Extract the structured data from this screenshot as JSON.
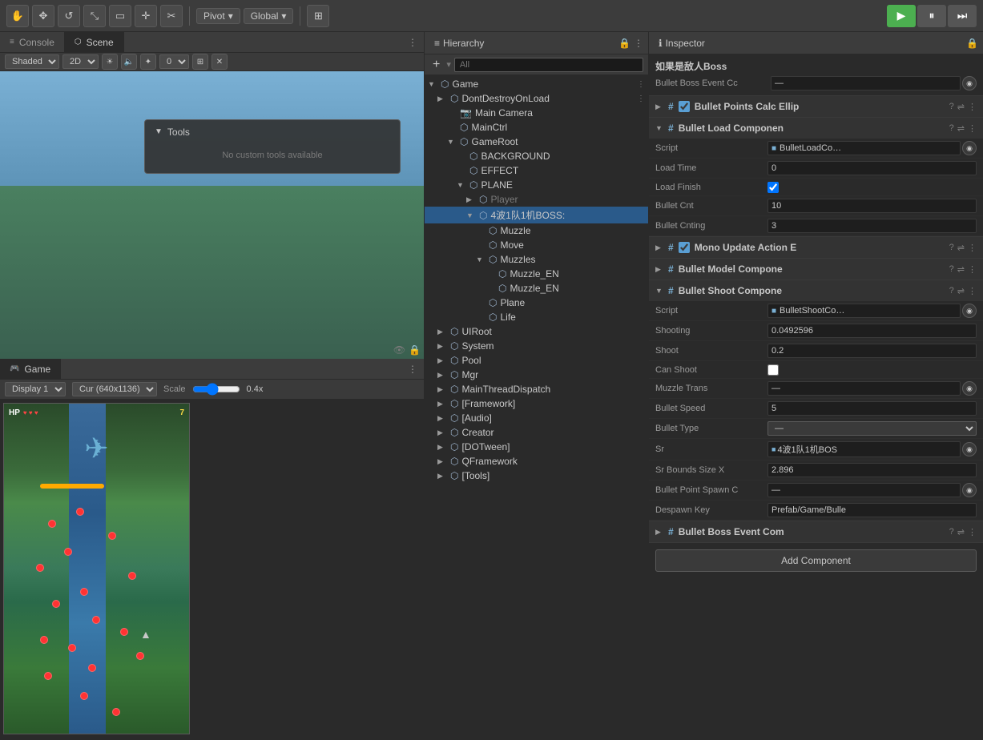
{
  "toolbar": {
    "pivot_label": "Pivot",
    "global_label": "Global",
    "shaded_label": "Shaded",
    "twoD_label": "2D",
    "play_label": "▶",
    "pause_label": "⏸",
    "step_label": "⏭"
  },
  "panels": {
    "console_label": "Console",
    "scene_label": "Scene",
    "hierarchy_label": "Hierarchy",
    "inspector_label": "Inspector",
    "game_label": "Game"
  },
  "scene_toolbar": {
    "shaded_option": "Shaded",
    "twoD_option": "2D"
  },
  "game_toolbar": {
    "display_label": "Display 1",
    "resolution_label": "Cur (640x1136)",
    "scale_label": "Scale",
    "scale_value": "0.4x"
  },
  "hierarchy": {
    "search_placeholder": "All",
    "add_label": "+",
    "items": [
      {
        "label": "Game",
        "indent": 0,
        "has_arrow": true,
        "arrow": "▼",
        "has_menu": true
      },
      {
        "label": "DontDestroyOnLoad",
        "indent": 1,
        "has_arrow": true,
        "arrow": "▶",
        "has_menu": true
      },
      {
        "label": "Main Camera",
        "indent": 2,
        "has_arrow": false
      },
      {
        "label": "MainCtrl",
        "indent": 2,
        "has_arrow": false
      },
      {
        "label": "GameRoot",
        "indent": 2,
        "has_arrow": true,
        "arrow": "▼"
      },
      {
        "label": "BACKGROUND",
        "indent": 3,
        "has_arrow": false
      },
      {
        "label": "EFFECT",
        "indent": 3,
        "has_arrow": false
      },
      {
        "label": "PLANE",
        "indent": 3,
        "has_arrow": true,
        "arrow": "▼"
      },
      {
        "label": "Player",
        "indent": 4,
        "has_arrow": false,
        "color": "gray"
      },
      {
        "label": "4波1队1机BOSS:",
        "indent": 4,
        "has_arrow": true,
        "arrow": "▼",
        "selected": true
      },
      {
        "label": "Muzzle",
        "indent": 5,
        "has_arrow": false
      },
      {
        "label": "Move",
        "indent": 5,
        "has_arrow": false
      },
      {
        "label": "Muzzles",
        "indent": 5,
        "has_arrow": true,
        "arrow": "▼"
      },
      {
        "label": "Muzzle_EN",
        "indent": 6,
        "has_arrow": false
      },
      {
        "label": "Muzzle_EN",
        "indent": 6,
        "has_arrow": false
      },
      {
        "label": "Plane",
        "indent": 5,
        "has_arrow": false
      },
      {
        "label": "Life",
        "indent": 5,
        "has_arrow": false
      },
      {
        "label": "UIRoot",
        "indent": 1,
        "has_arrow": true,
        "arrow": "▶"
      },
      {
        "label": "System",
        "indent": 1,
        "has_arrow": true,
        "arrow": "▶"
      },
      {
        "label": "Pool",
        "indent": 1,
        "has_arrow": true,
        "arrow": "▶"
      },
      {
        "label": "Mgr",
        "indent": 1,
        "has_arrow": true,
        "arrow": "▶"
      },
      {
        "label": "MainThreadDispatch",
        "indent": 1,
        "has_arrow": true,
        "arrow": "▶"
      },
      {
        "label": "[Framework]",
        "indent": 1,
        "has_arrow": true,
        "arrow": "▶"
      },
      {
        "label": "[Audio]",
        "indent": 1,
        "has_arrow": true,
        "arrow": "▶"
      },
      {
        "label": "Creator",
        "indent": 1,
        "has_arrow": true,
        "arrow": "▶"
      },
      {
        "label": "[DOTween]",
        "indent": 1,
        "has_arrow": true,
        "arrow": "▶"
      },
      {
        "label": "QFramework",
        "indent": 1,
        "has_arrow": true,
        "arrow": "▶"
      },
      {
        "label": "[Tools]",
        "indent": 1,
        "has_arrow": true,
        "arrow": "▶"
      }
    ]
  },
  "inspector": {
    "title_label": "Inspector",
    "boss_header": "如果是敌人Boss",
    "bullet_boss_event_label": "Bullet Boss Event Cc",
    "bullet_boss_event_value": "—",
    "sections": [
      {
        "id": "bullet_points_calc",
        "title": "Bullet Points Calc Ellip",
        "expanded": false,
        "has_check": true,
        "checked": true
      },
      {
        "id": "bullet_load",
        "title": "Bullet Load Componen",
        "expanded": true,
        "has_check": false,
        "rows": [
          {
            "label": "Script",
            "value": "BulletLoadCo…",
            "type": "script"
          },
          {
            "label": "Load Time",
            "value": "0",
            "type": "text"
          },
          {
            "label": "Load Finish",
            "value": "✓",
            "type": "check"
          },
          {
            "label": "Bullet Cnt",
            "value": "10",
            "type": "text"
          },
          {
            "label": "Bullet Cnting",
            "value": "3",
            "type": "text"
          }
        ]
      },
      {
        "id": "mono_update_action",
        "title": "Mono Update Action E",
        "expanded": false,
        "has_check": true,
        "checked": true
      },
      {
        "id": "bullet_model",
        "title": "Bullet Model Compone",
        "expanded": false,
        "has_check": false
      },
      {
        "id": "bullet_shoot",
        "title": "Bullet Shoot Compone",
        "expanded": true,
        "has_check": false,
        "rows": [
          {
            "label": "Script",
            "value": "BulletShootCo…",
            "type": "script"
          },
          {
            "label": "Shooting",
            "value": "0.0492596",
            "type": "text"
          },
          {
            "label": "Shoot",
            "value": "0.2",
            "type": "text"
          },
          {
            "label": "Can Shoot",
            "value": "",
            "type": "checkbox_unchecked"
          },
          {
            "label": "Muzzle Trans",
            "value": "—",
            "type": "field_btn"
          },
          {
            "label": "Bullet Speed",
            "value": "5",
            "type": "text"
          },
          {
            "label": "Bullet Type",
            "value": "—",
            "type": "dropdown"
          },
          {
            "label": "Sr",
            "value": "4波1队1机BOS",
            "type": "field_btn_prefixed"
          },
          {
            "label": "Sr Bounds Size X",
            "value": "2.896",
            "type": "text"
          },
          {
            "label": "Bullet Point Spawn C",
            "value": "—",
            "type": "field_btn"
          },
          {
            "label": "Despawn Key",
            "value": "Prefab/Game/Bulle",
            "type": "text"
          }
        ]
      },
      {
        "id": "bullet_boss_event",
        "title": "Bullet Boss Event Com",
        "expanded": false,
        "has_check": false
      }
    ],
    "add_component_label": "Add Component"
  },
  "tools": {
    "header": "Tools",
    "content": "No custom tools available"
  },
  "game": {
    "hp_label": "HP",
    "score": "7"
  }
}
